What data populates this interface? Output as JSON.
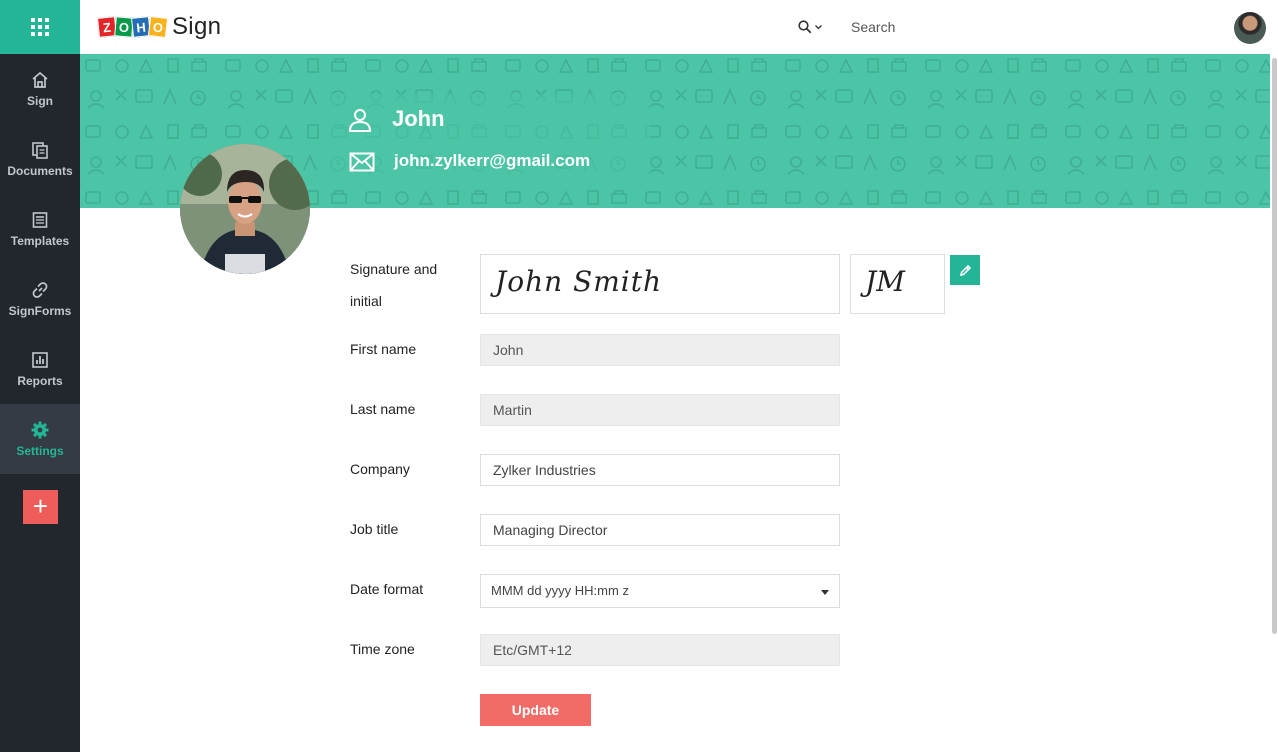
{
  "header": {
    "logo_letters": [
      "Z",
      "O",
      "H",
      "O"
    ],
    "logo_colors": [
      "#e42527",
      "#089949",
      "#226db4",
      "#f9b21d"
    ],
    "product_name": "Sign",
    "search_placeholder": "Search"
  },
  "sidebar": {
    "items": [
      {
        "label": "Sign",
        "icon": "home-icon",
        "active": false
      },
      {
        "label": "Documents",
        "icon": "documents-icon",
        "active": false
      },
      {
        "label": "Templates",
        "icon": "templates-icon",
        "active": false
      },
      {
        "label": "SignForms",
        "icon": "link-icon",
        "active": false
      },
      {
        "label": "Reports",
        "icon": "reports-icon",
        "active": false
      },
      {
        "label": "Settings",
        "icon": "gear-icon",
        "active": true
      }
    ],
    "add_label": "+"
  },
  "profile": {
    "name": "John",
    "email": "john.zylkerr@gmail.com"
  },
  "form": {
    "signature_label_line1": "Signature and",
    "signature_label_line2": "initial",
    "signature_text": "John Smith",
    "initial_text": "JM",
    "first_name_label": "First name",
    "first_name_value": "John",
    "last_name_label": "Last name",
    "last_name_value": "Martin",
    "company_label": "Company",
    "company_value": "Zylker Industries",
    "job_title_label": "Job title",
    "job_title_value": "Managing Director",
    "date_format_label": "Date format",
    "date_format_value": "MMM dd yyyy HH:mm z",
    "time_zone_label": "Time zone",
    "time_zone_value": "Etc/GMT+12",
    "update_label": "Update"
  },
  "colors": {
    "accent": "#23b596",
    "banner": "#4cc5a6",
    "sidebar": "#22262d",
    "update_button": "#f16b67",
    "add_button": "#ef5d5a"
  }
}
